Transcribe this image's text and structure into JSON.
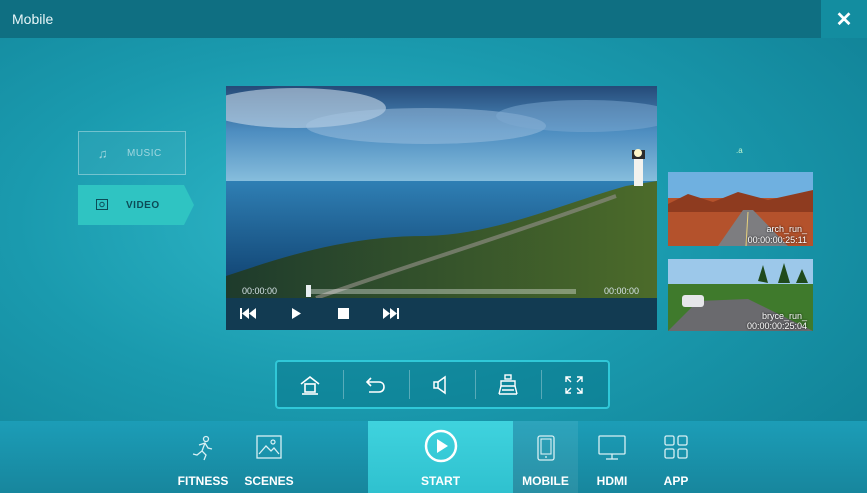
{
  "window": {
    "title": "Mobile",
    "close_icon": "close-icon"
  },
  "media_tabs": [
    {
      "label": "MUSIC",
      "icon": "music-note-icon",
      "selected": false
    },
    {
      "label": "VIDEO",
      "icon": "video-icon",
      "selected": true
    }
  ],
  "player": {
    "current_time": "00:00:00",
    "total_time": "00:00:00",
    "progress": 0,
    "controls": [
      "rewind-icon",
      "play-icon",
      "stop-icon",
      "fast-forward-icon"
    ]
  },
  "playlist": {
    "marker": ".a",
    "items": [
      {
        "name": "arch_run_",
        "duration": "00:00:00:25:11"
      },
      {
        "name": "bryce_run_",
        "duration": "00:00:00:25:04"
      }
    ]
  },
  "toolbar": {
    "items": [
      "home-icon",
      "back-icon",
      "volume-icon",
      "rail-icon",
      "fullscreen-icon"
    ]
  },
  "bottom_nav": {
    "fitness": "FITNESS",
    "scenes": "SCENES",
    "start": "START",
    "mobile": "MOBILE",
    "hdmi": "HDMI",
    "app": "APP",
    "active": "MOBILE"
  },
  "colors": {
    "accent": "#2fc4c2",
    "titlebar": "#0f6f82",
    "start_bg": "#3fd3de"
  }
}
